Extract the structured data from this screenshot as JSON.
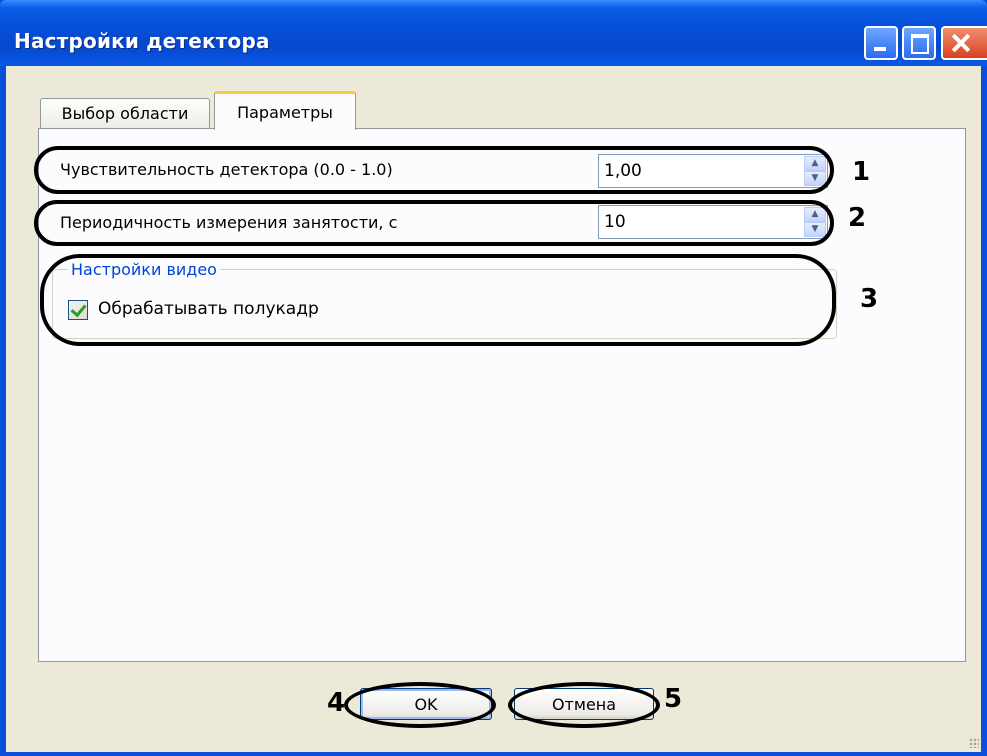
{
  "window": {
    "title": "Настройки детектора"
  },
  "tabs": [
    {
      "label": "Выбор области",
      "active": false
    },
    {
      "label": "Параметры",
      "active": true
    }
  ],
  "params": {
    "sensitivity_label": "Чувствительность детектора (0.0 - 1.0)",
    "sensitivity_value": "1,00",
    "period_label": "Периодичность измерения занятости, с",
    "period_value": "10"
  },
  "video_group": {
    "legend": "Настройки видео",
    "checkbox_label": "Обрабатывать полукадр",
    "checked": true
  },
  "buttons": {
    "ok": "OK",
    "cancel": "Отмена"
  },
  "callouts": [
    "1",
    "2",
    "3",
    "4",
    "5"
  ],
  "colors": {
    "titlebar": "#0650d8",
    "dialog_bg": "#ece9d8",
    "active_tab_accent": "#ffc83c",
    "group_legend": "#0046d5",
    "checkmark": "#21a121"
  }
}
